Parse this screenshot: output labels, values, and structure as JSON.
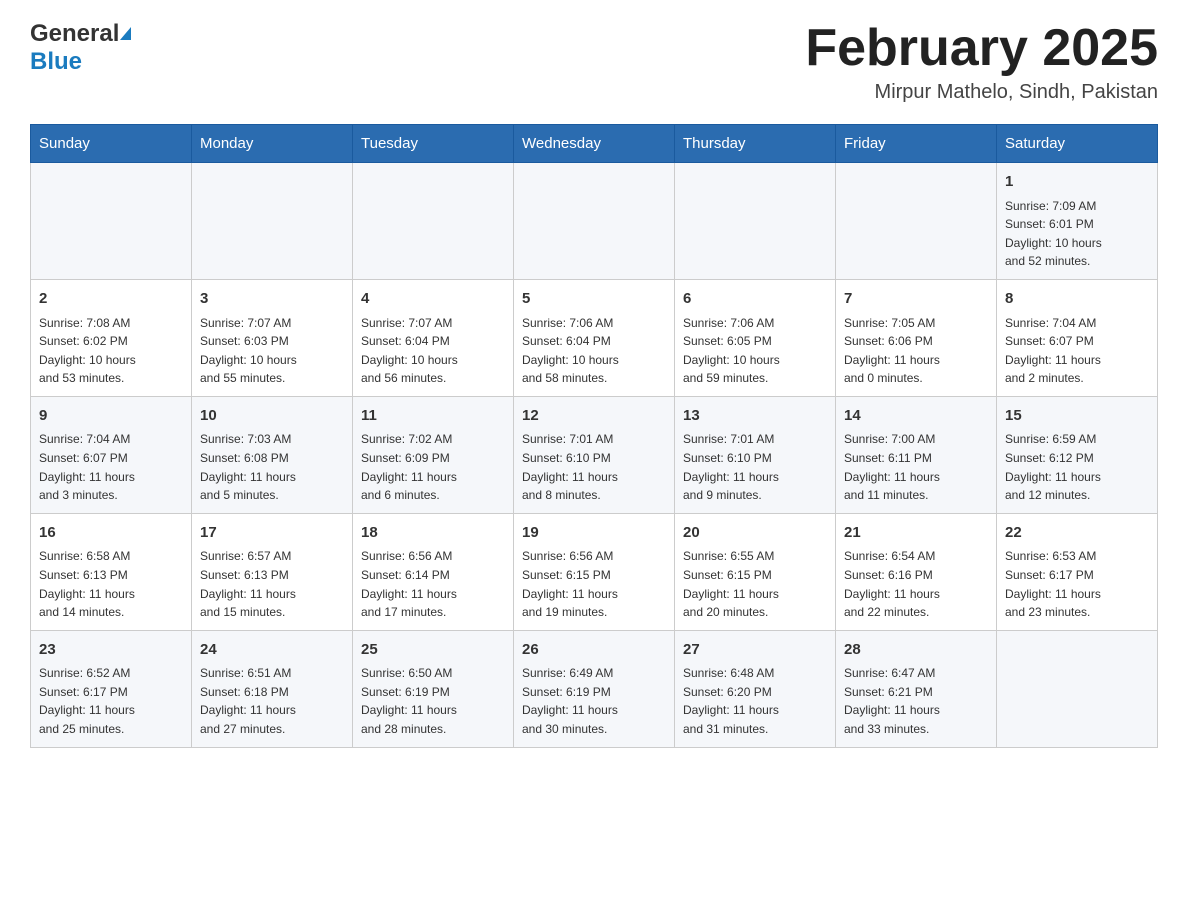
{
  "header": {
    "logo_general": "General",
    "logo_blue": "Blue",
    "month_title": "February 2025",
    "location": "Mirpur Mathelo, Sindh, Pakistan"
  },
  "days_of_week": [
    "Sunday",
    "Monday",
    "Tuesday",
    "Wednesday",
    "Thursday",
    "Friday",
    "Saturday"
  ],
  "weeks": [
    {
      "days": [
        {
          "number": "",
          "info": ""
        },
        {
          "number": "",
          "info": ""
        },
        {
          "number": "",
          "info": ""
        },
        {
          "number": "",
          "info": ""
        },
        {
          "number": "",
          "info": ""
        },
        {
          "number": "",
          "info": ""
        },
        {
          "number": "1",
          "info": "Sunrise: 7:09 AM\nSunset: 6:01 PM\nDaylight: 10 hours\nand 52 minutes."
        }
      ]
    },
    {
      "days": [
        {
          "number": "2",
          "info": "Sunrise: 7:08 AM\nSunset: 6:02 PM\nDaylight: 10 hours\nand 53 minutes."
        },
        {
          "number": "3",
          "info": "Sunrise: 7:07 AM\nSunset: 6:03 PM\nDaylight: 10 hours\nand 55 minutes."
        },
        {
          "number": "4",
          "info": "Sunrise: 7:07 AM\nSunset: 6:04 PM\nDaylight: 10 hours\nand 56 minutes."
        },
        {
          "number": "5",
          "info": "Sunrise: 7:06 AM\nSunset: 6:04 PM\nDaylight: 10 hours\nand 58 minutes."
        },
        {
          "number": "6",
          "info": "Sunrise: 7:06 AM\nSunset: 6:05 PM\nDaylight: 10 hours\nand 59 minutes."
        },
        {
          "number": "7",
          "info": "Sunrise: 7:05 AM\nSunset: 6:06 PM\nDaylight: 11 hours\nand 0 minutes."
        },
        {
          "number": "8",
          "info": "Sunrise: 7:04 AM\nSunset: 6:07 PM\nDaylight: 11 hours\nand 2 minutes."
        }
      ]
    },
    {
      "days": [
        {
          "number": "9",
          "info": "Sunrise: 7:04 AM\nSunset: 6:07 PM\nDaylight: 11 hours\nand 3 minutes."
        },
        {
          "number": "10",
          "info": "Sunrise: 7:03 AM\nSunset: 6:08 PM\nDaylight: 11 hours\nand 5 minutes."
        },
        {
          "number": "11",
          "info": "Sunrise: 7:02 AM\nSunset: 6:09 PM\nDaylight: 11 hours\nand 6 minutes."
        },
        {
          "number": "12",
          "info": "Sunrise: 7:01 AM\nSunset: 6:10 PM\nDaylight: 11 hours\nand 8 minutes."
        },
        {
          "number": "13",
          "info": "Sunrise: 7:01 AM\nSunset: 6:10 PM\nDaylight: 11 hours\nand 9 minutes."
        },
        {
          "number": "14",
          "info": "Sunrise: 7:00 AM\nSunset: 6:11 PM\nDaylight: 11 hours\nand 11 minutes."
        },
        {
          "number": "15",
          "info": "Sunrise: 6:59 AM\nSunset: 6:12 PM\nDaylight: 11 hours\nand 12 minutes."
        }
      ]
    },
    {
      "days": [
        {
          "number": "16",
          "info": "Sunrise: 6:58 AM\nSunset: 6:13 PM\nDaylight: 11 hours\nand 14 minutes."
        },
        {
          "number": "17",
          "info": "Sunrise: 6:57 AM\nSunset: 6:13 PM\nDaylight: 11 hours\nand 15 minutes."
        },
        {
          "number": "18",
          "info": "Sunrise: 6:56 AM\nSunset: 6:14 PM\nDaylight: 11 hours\nand 17 minutes."
        },
        {
          "number": "19",
          "info": "Sunrise: 6:56 AM\nSunset: 6:15 PM\nDaylight: 11 hours\nand 19 minutes."
        },
        {
          "number": "20",
          "info": "Sunrise: 6:55 AM\nSunset: 6:15 PM\nDaylight: 11 hours\nand 20 minutes."
        },
        {
          "number": "21",
          "info": "Sunrise: 6:54 AM\nSunset: 6:16 PM\nDaylight: 11 hours\nand 22 minutes."
        },
        {
          "number": "22",
          "info": "Sunrise: 6:53 AM\nSunset: 6:17 PM\nDaylight: 11 hours\nand 23 minutes."
        }
      ]
    },
    {
      "days": [
        {
          "number": "23",
          "info": "Sunrise: 6:52 AM\nSunset: 6:17 PM\nDaylight: 11 hours\nand 25 minutes."
        },
        {
          "number": "24",
          "info": "Sunrise: 6:51 AM\nSunset: 6:18 PM\nDaylight: 11 hours\nand 27 minutes."
        },
        {
          "number": "25",
          "info": "Sunrise: 6:50 AM\nSunset: 6:19 PM\nDaylight: 11 hours\nand 28 minutes."
        },
        {
          "number": "26",
          "info": "Sunrise: 6:49 AM\nSunset: 6:19 PM\nDaylight: 11 hours\nand 30 minutes."
        },
        {
          "number": "27",
          "info": "Sunrise: 6:48 AM\nSunset: 6:20 PM\nDaylight: 11 hours\nand 31 minutes."
        },
        {
          "number": "28",
          "info": "Sunrise: 6:47 AM\nSunset: 6:21 PM\nDaylight: 11 hours\nand 33 minutes."
        },
        {
          "number": "",
          "info": ""
        }
      ]
    }
  ]
}
